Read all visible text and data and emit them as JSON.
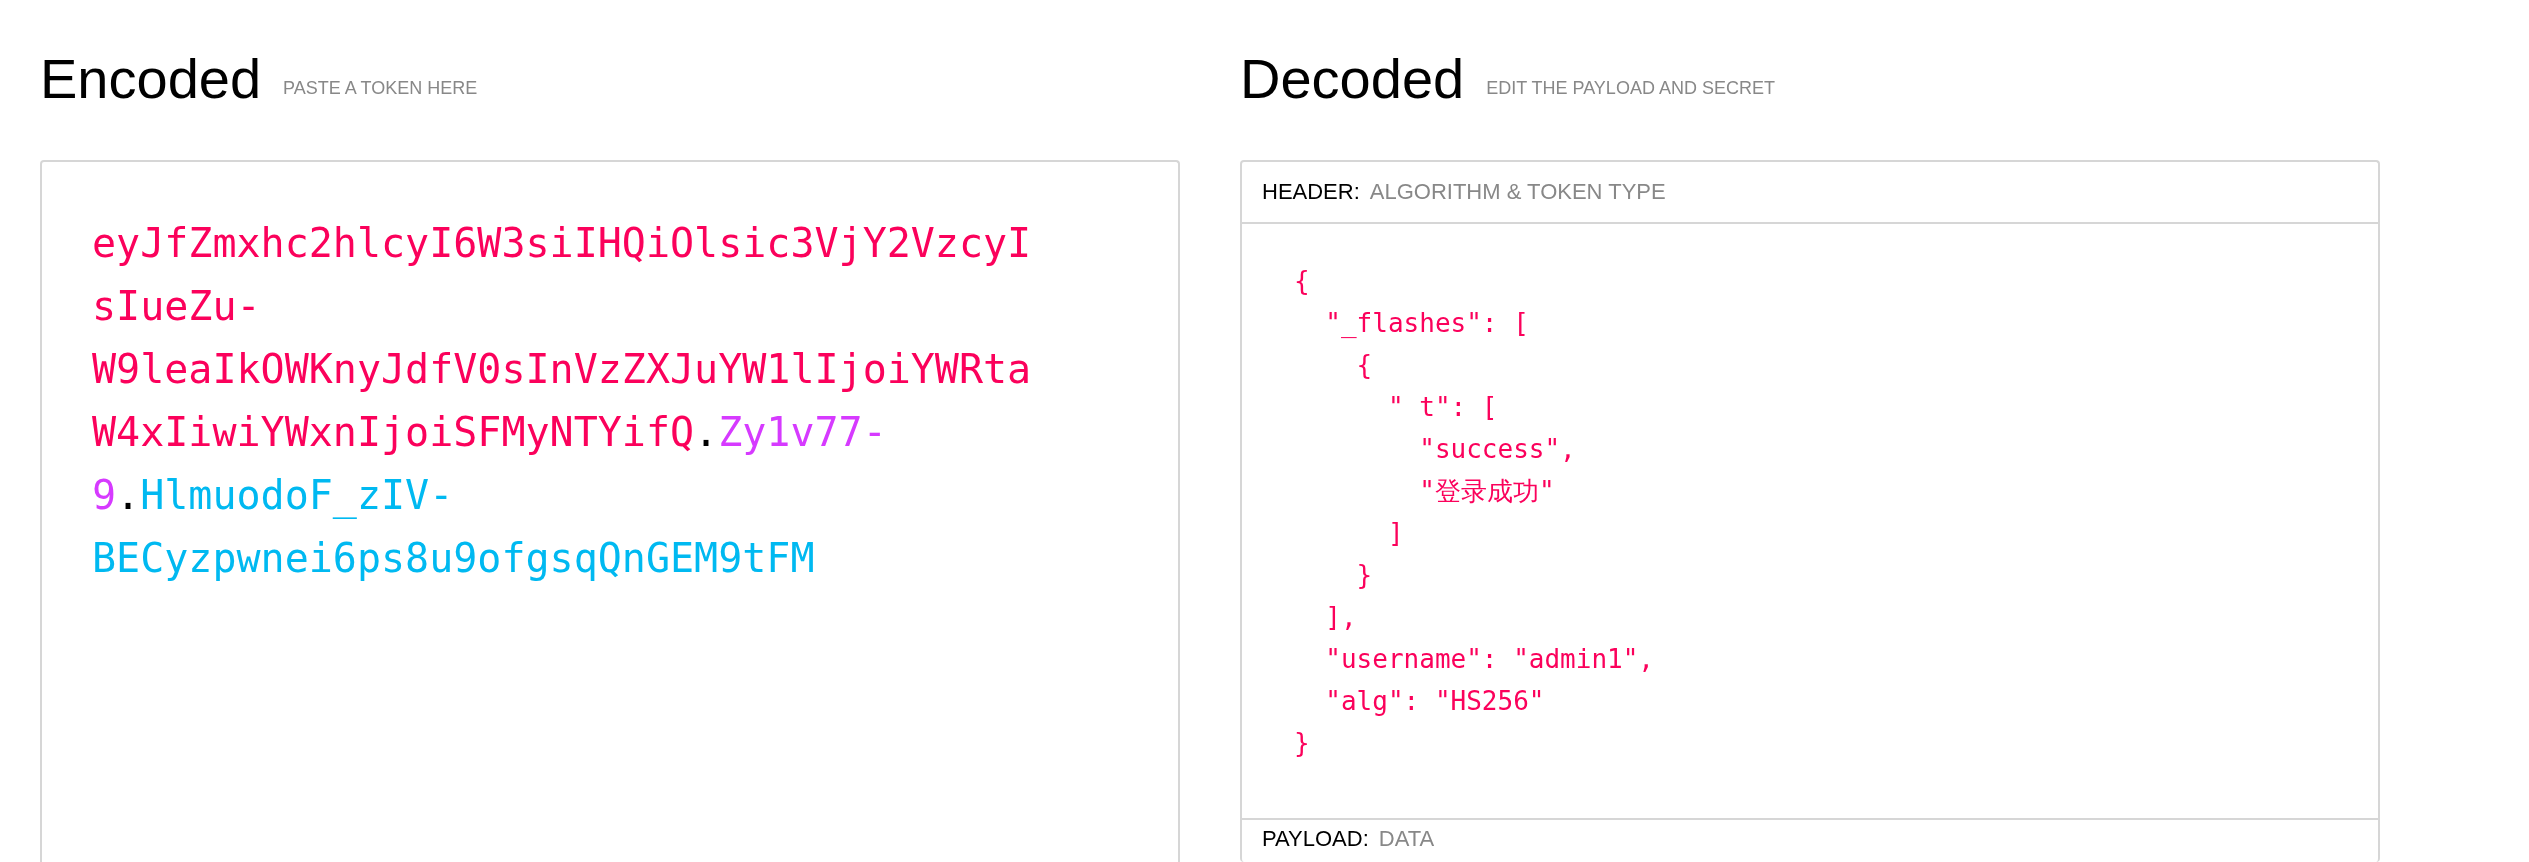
{
  "encoded": {
    "title": "Encoded",
    "hint": "PASTE A TOKEN HERE",
    "token_lines": [
      [
        {
          "text": "eyJfZmxhc2hlcyI6W3siIHQiOlsic3VjY2VzcyI",
          "kind": "header"
        }
      ],
      [
        {
          "text": "sIueZu-",
          "kind": "header"
        }
      ],
      [
        {
          "text": "W9leaIkOWKnyJdfV0sInVzZXJuYW1lIjoiYWRta",
          "kind": "header"
        }
      ],
      [
        {
          "text": "W4xIiwiYWxnIjoiSFMyNTYifQ",
          "kind": "header"
        },
        {
          "text": ".",
          "kind": "dot"
        },
        {
          "text": "Zy1v77-",
          "kind": "payload"
        }
      ],
      [
        {
          "text": "9",
          "kind": "payload"
        },
        {
          "text": ".",
          "kind": "dot"
        },
        {
          "text": "HlmuodoF_zIV-",
          "kind": "signature"
        }
      ],
      [
        {
          "text": "BECyzpwnei6ps8u9ofgsqQnGEM9tFM",
          "kind": "signature"
        }
      ]
    ]
  },
  "decoded": {
    "title": "Decoded",
    "hint": "EDIT THE PAYLOAD AND SECRET",
    "header": {
      "label": "HEADER:",
      "hint": "ALGORITHM & TOKEN TYPE",
      "lines": [
        "{",
        "  \"_flashes\": [",
        "    {",
        "      \" t\": [",
        "        \"success\",",
        "        \"登录成功\"",
        "      ]",
        "    }",
        "  ],",
        "  \"username\": \"admin1\",",
        "  \"alg\": \"HS256\"",
        "}"
      ]
    },
    "payload": {
      "label": "PAYLOAD:",
      "hint": "DATA"
    }
  }
}
